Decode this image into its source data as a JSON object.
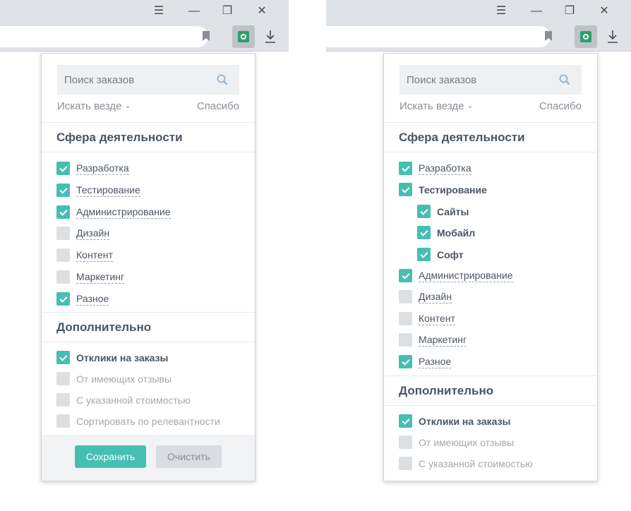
{
  "browser": {
    "menu_icon": "hamburger-icon",
    "minimize_icon": "minimize-icon",
    "restore_icon": "restore-icon",
    "close_icon": "close-icon"
  },
  "popup": {
    "search_placeholder": "Поиск заказов",
    "search_scope": "Искать везде",
    "thanks_link": "Спасибо",
    "section_activity": "Сфера деятельности",
    "section_extra": "Дополнительно",
    "save_button": "Сохранить",
    "clear_button": "Очистить"
  },
  "left": {
    "activity": [
      {
        "label": "Разработка",
        "checked": true
      },
      {
        "label": "Тестирование",
        "checked": true
      },
      {
        "label": "Администрирование",
        "checked": true
      },
      {
        "label": "Дизайн",
        "checked": false
      },
      {
        "label": "Контент",
        "checked": false
      },
      {
        "label": "Маркетинг",
        "checked": false
      },
      {
        "label": "Разное",
        "checked": true
      }
    ],
    "extra": [
      {
        "label": "Отклики на заказы",
        "checked": true
      },
      {
        "label": "От имеющих отзывы",
        "checked": false
      },
      {
        "label": "С указанной стоимостью",
        "checked": false
      },
      {
        "label": "Сортировать по релевантности",
        "checked": false
      }
    ]
  },
  "right": {
    "activity": [
      {
        "label": "Разработка",
        "checked": true
      },
      {
        "label": "Тестирование",
        "checked": true
      },
      {
        "label": "Сайты",
        "checked": true
      },
      {
        "label": "Мобайл",
        "checked": true
      },
      {
        "label": "Софт",
        "checked": true
      },
      {
        "label": "Администрирование",
        "checked": true
      },
      {
        "label": "Дизайн",
        "checked": false
      },
      {
        "label": "Контент",
        "checked": false
      },
      {
        "label": "Маркетинг",
        "checked": false
      },
      {
        "label": "Разное",
        "checked": true
      }
    ],
    "extra": [
      {
        "label": "Отклики на заказы",
        "checked": true
      },
      {
        "label": "От имеющих отзывы",
        "checked": false
      },
      {
        "label": "С указанной стоимостью",
        "checked": false
      }
    ]
  },
  "colors": {
    "accent": "#46bfb2",
    "extension": "#2e9f6d",
    "chrome_bg": "#dfe3e8"
  }
}
